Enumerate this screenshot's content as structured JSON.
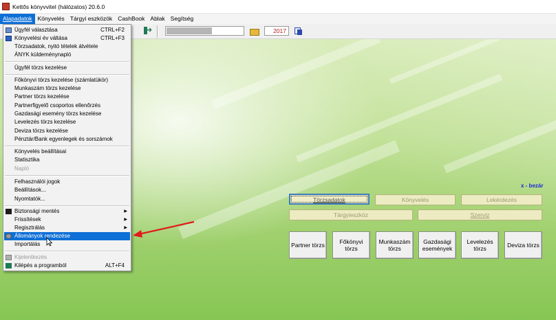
{
  "window": {
    "title": "Kettős könyvvitel (hálózatos) 20.6.0"
  },
  "menubar": [
    {
      "label": "Alapadatok",
      "active": true
    },
    {
      "label": "Könyvelés",
      "active": false
    },
    {
      "label": "Tárgyi eszközök",
      "active": false
    },
    {
      "label": "CashBook",
      "active": false
    },
    {
      "label": "Ablak",
      "active": false
    },
    {
      "label": "Segítség",
      "active": false
    }
  ],
  "toolbar": {
    "year": "2017",
    "icons": [
      "exit-icon",
      "folder-icon",
      "swap-icon"
    ]
  },
  "menu": {
    "items": [
      {
        "label": "Ügyfél választása",
        "shortcut": "CTRL+F2",
        "icon": "client-icon"
      },
      {
        "label": "Könyvelési év váltása",
        "shortcut": "CTRL+F3",
        "icon": "year-icon"
      },
      {
        "label": "Törzsadatok, nyitó tételek átvétele"
      },
      {
        "label": "ÁNYK küldeménynapló"
      },
      {
        "label": "Ügyfél törzs kezelése"
      },
      {
        "label": "Főkönyvi törzs kezelése (számlatükör)"
      },
      {
        "label": "Munkaszám törzs kezelése"
      },
      {
        "label": "Partner törzs kezelése"
      },
      {
        "label": "Partnerfigyelő csoportos ellenőrzés"
      },
      {
        "label": "Gazdasági esemény törzs kezelése"
      },
      {
        "label": "Levelezés törzs kezelése"
      },
      {
        "label": "Deviza törzs kezelése"
      },
      {
        "label": "Pénztár/Bank egyenlegek és sorszámok"
      },
      {
        "label": "Könyvelés beállításai"
      },
      {
        "label": "Statisztika"
      },
      {
        "label": "Napló",
        "disabled": true
      },
      {
        "label": "Felhasználói jogok"
      },
      {
        "label": "Beállítások..."
      },
      {
        "label": "Nyomtatók..."
      },
      {
        "label": "Biztonsági mentés",
        "submenu": true,
        "icon": "backup-icon"
      },
      {
        "label": "Frissítések",
        "submenu": true
      },
      {
        "label": "Regisztrálás",
        "submenu": true
      },
      {
        "label": "Állományok rendezése",
        "highlighted": true,
        "icon": "gears-icon"
      },
      {
        "label": "Importálás"
      },
      {
        "label": "Kijelentkezés",
        "disabled": true,
        "icon": "logout-icon"
      },
      {
        "label": "Kilépés a programból",
        "shortcut": "ALT+F4",
        "icon": "exit-icon"
      }
    ]
  },
  "panel": {
    "close_label": "x - bezár",
    "categories": [
      {
        "label": "Törzsadatok",
        "selected": true
      },
      {
        "label": "Könyvelés",
        "selected": false
      },
      {
        "label": "Lekérdezés",
        "selected": false
      },
      {
        "label": "Tárgyieszköz",
        "selected": false
      },
      {
        "label": "Szerviz",
        "selected": false
      }
    ],
    "modules": [
      {
        "line1": "Partner törzs",
        "line2": ""
      },
      {
        "line1": "Főkönyvi törzs",
        "line2": ""
      },
      {
        "line1": "Munkaszám",
        "line2": "törzs"
      },
      {
        "line1": "Gazdasági",
        "line2": "események"
      },
      {
        "line1": "Levelezés",
        "line2": "törzs"
      },
      {
        "line1": "Deviza törzs",
        "line2": ""
      }
    ]
  },
  "colors": {
    "menu_highlight": "#0e6fd6",
    "annotation_arrow": "#e01b1b",
    "year_text": "#b21a1a",
    "close_link": "#1a2bd6"
  }
}
